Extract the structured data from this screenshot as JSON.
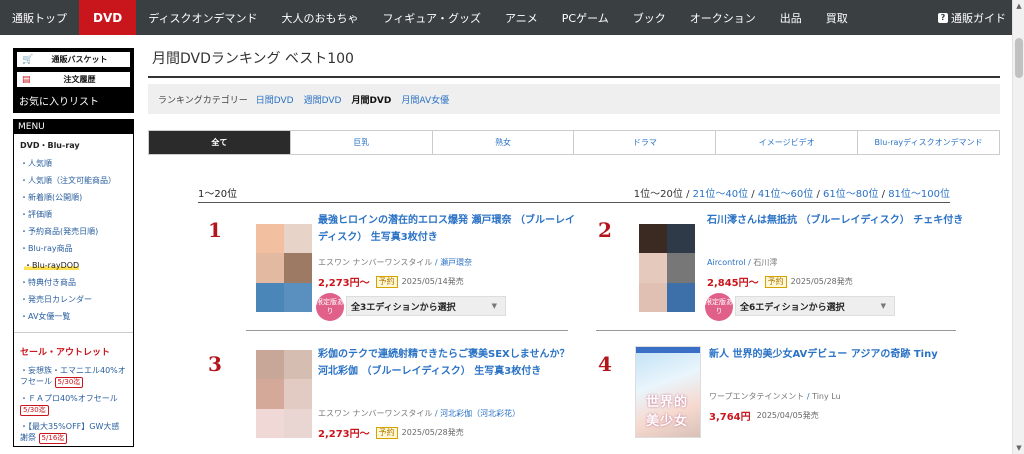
{
  "nav": {
    "items": [
      "通販トップ",
      "DVD",
      "ディスクオンデマンド",
      "大人のおもちゃ",
      "フィギュア・グッズ",
      "アニメ",
      "PCゲーム",
      "ブック",
      "オークション",
      "出品",
      "買取"
    ],
    "guide": "通販ガイド",
    "guide_icon": "?",
    "active_color": "#c9161d"
  },
  "account": {
    "basket": "通販バスケット",
    "history": "注文履歴",
    "favorites": "お気に入りリスト"
  },
  "menu": {
    "header": "MENU",
    "section": "DVD・Blu-ray",
    "items": [
      "・人気順",
      "・人気順（注文可能商品）",
      "・新着順(公開順)",
      "・評価順",
      "・予約商品(発売日順)",
      "・Blu-ray商品"
    ],
    "sub_item": "・Blu-rayDOD",
    "items2": [
      "・特典付き商品",
      "・発売日カレンダー",
      "・AV女優一覧"
    ],
    "sale_header": "セール・アウトレット",
    "sale_items": [
      {
        "text": "・妄想族・エマニエル40%オフセール",
        "badge": "5/30迄"
      },
      {
        "text": "・ＦＡプロ40%オフセール",
        "badge": "5/30迄"
      },
      {
        "text": "・【最大35%OFF】GW大感謝祭",
        "badge": "5/16迄"
      }
    ]
  },
  "page": {
    "title": "月間DVDランキング ベスト100",
    "category_label": "ランキングカテゴリー",
    "categories": [
      "日間DVD",
      "週間DVD",
      "月間DVD",
      "月間AV女優"
    ],
    "current_category": "月間DVD",
    "tabs": [
      "全て",
      "巨乳",
      "熟女",
      "ドラマ",
      "イメージビデオ",
      "Blu-rayディスクオンデマンド"
    ],
    "range_current": "1〜20位",
    "range_links_prefix": "1位〜20位",
    "range_links": [
      "21位〜40位",
      "41位〜60位",
      "61位〜80位",
      "81位〜100位"
    ]
  },
  "products": [
    {
      "rank": "1",
      "title": "最強ヒロインの潜在的エロス爆発 瀬戸環奈 （ブルーレイディスク） 生写真3枚付き",
      "maker": "エスワン ナンバーワンスタイル",
      "actress": "瀬戸環奈",
      "price": "2,273円〜",
      "reserve": "予約",
      "release": "2025/05/14発売",
      "limited": "限定版あり",
      "editions": "全3エディションから選択",
      "thumb_colors": [
        "#f2bfa0",
        "#e8d3c9",
        "#e3b9a2",
        "#9d7a64",
        "#4a86b8",
        "#5a90c0"
      ]
    },
    {
      "rank": "2",
      "title": "石川澪さんは無抵抗 （ブルーレイディスク） チェキ付き",
      "maker": "Aircontrol",
      "actress": "石川澪",
      "price": "2,845円〜",
      "reserve": "予約",
      "release": "2025/05/28発売",
      "limited": "限定版あり",
      "editions": "全6エディションから選択",
      "thumb_colors": [
        "#3b2a22",
        "#2f3a48",
        "#e6c9bd",
        "#777777",
        "#dfc0b3",
        "#3d6fa8"
      ]
    },
    {
      "rank": "3",
      "title": "彩伽のテクで連続射精できたらご褒美SEXしませんか？ 河北彩伽 （ブルーレイディスク） 生写真3枚付き",
      "maker": "エスワン ナンバーワンスタイル",
      "actress": "河北彩伽（河北彩花）",
      "price": "2,273円〜",
      "reserve": "予約",
      "release": "2025/05/28発売",
      "thumb_colors": [
        "#c8a698",
        "#d6bdb2",
        "#d4a999",
        "#e1cbc2",
        "#f0d8d6",
        "#e9d6d2"
      ]
    },
    {
      "rank": "4",
      "title": "新人 世界的美少女AVデビュー アジアの奇跡 Tiny",
      "maker": "ワープエンタテインメント",
      "actress": "Tiny Lu",
      "price": "3,764円",
      "release": "2025/04/05発売",
      "cover_text": "世界的美少女"
    }
  ]
}
